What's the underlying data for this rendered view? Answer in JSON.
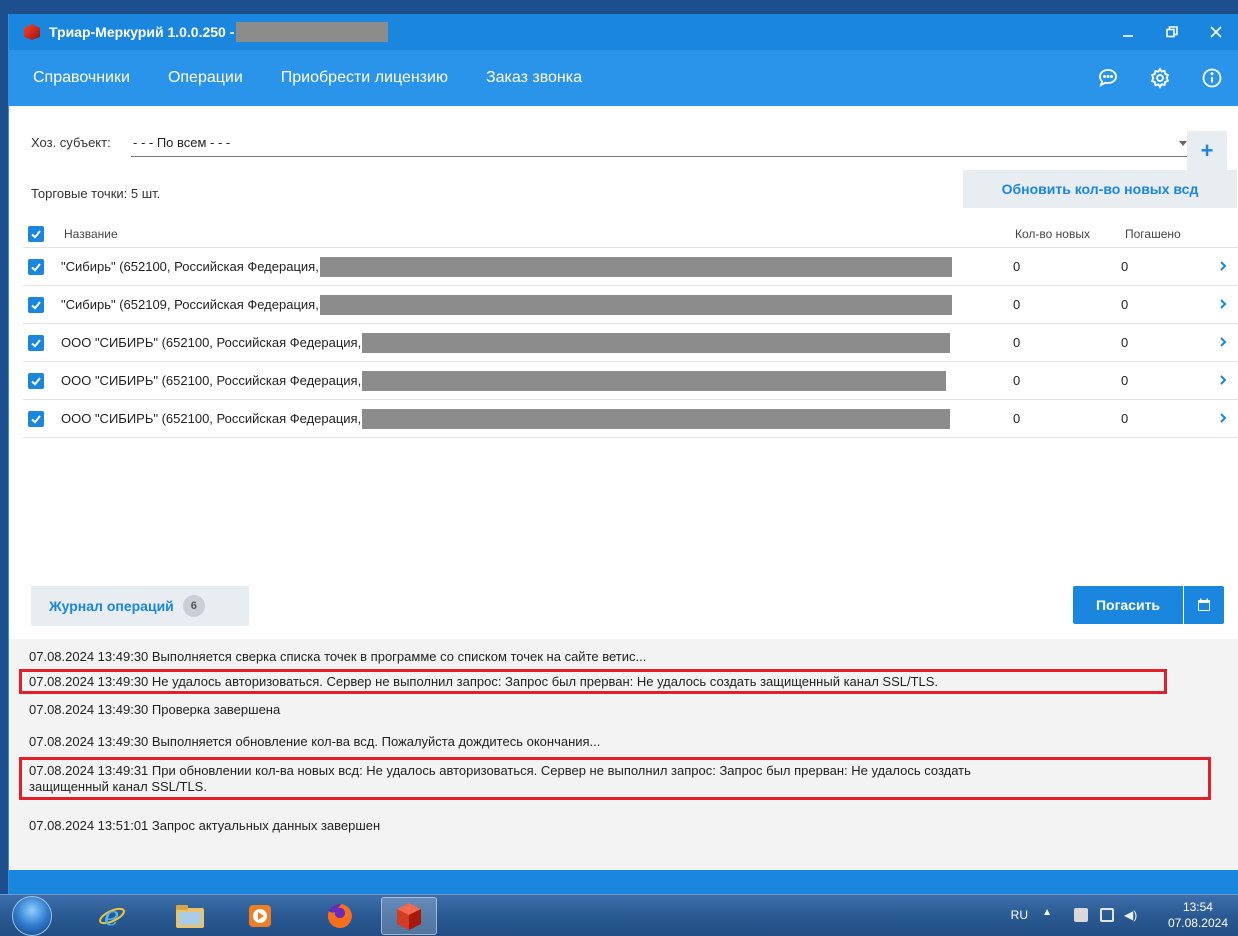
{
  "window": {
    "title": "Триар-Меркурий 1.0.0.250 -"
  },
  "menu": {
    "items": [
      "Справочники",
      "Операции",
      "Приобрести лицензию",
      "Заказ звонка"
    ]
  },
  "subject": {
    "label": "Хоз. субъект:",
    "value": "- - - По всем - - -"
  },
  "points": {
    "count_label": "Торговые точки: 5 шт.",
    "update_button": "Обновить кол-во новых всд"
  },
  "table": {
    "headers": {
      "name": "Название",
      "new": "Кол-во новых",
      "paid": "Погашено"
    },
    "rows": [
      {
        "name": "\"Сибирь\" (652100, Российская Федерация,",
        "new": "0",
        "paid": "0",
        "checked": true
      },
      {
        "name": "\"Сибирь\" (652109, Российская Федерация,",
        "new": "0",
        "paid": "0",
        "checked": true
      },
      {
        "name": "ООО \"СИБИРЬ\" (652100, Российская Федерация,",
        "new": "0",
        "paid": "0",
        "checked": true
      },
      {
        "name": "ООО \"СИБИРЬ\" (652100, Российская Федерация,",
        "new": "0",
        "paid": "0",
        "checked": true
      },
      {
        "name": "ООО \"СИБИРЬ\" (652100, Российская Федерация,",
        "new": "0",
        "paid": "0",
        "checked": true
      }
    ]
  },
  "journal": {
    "label": "Журнал операций",
    "count": "6"
  },
  "actions": {
    "pay_label": "Погасить"
  },
  "log": [
    "07.08.2024 13:49:30  Выполняется сверка списка точек в программе со списком точек на сайте ветис...",
    "07.08.2024 13:49:30  Не удалось авторизоваться.  Сервер не выполнил запрос:  Запрос был прерван: Не удалось создать защищенный канал SSL/TLS.",
    "07.08.2024 13:49:30  Проверка завершена",
    "07.08.2024 13:49:30  Выполняется обновление кол-ва всд. Пожалуйста дождитесь окончания...",
    "07.08.2024 13:49:31  При обновлении кол-ва новых всд: Не удалось авторизоваться.  Сервер не выполнил запрос:  Запрос был прерван: Не удалось создать",
    "защищенный канал SSL/TLS.",
    "07.08.2024 13:51:01  Запрос актуальных данных завершен"
  ],
  "taskbar": {
    "lang": "RU",
    "time": "13:54",
    "date": "07.08.2024"
  },
  "colors": {
    "accent": "#1a86de",
    "menu_bg": "#2a93ea",
    "highlight_border": "#e3202a"
  },
  "icons": [
    "app-icon",
    "minimize-icon",
    "restore-icon",
    "close-icon",
    "chat-icon",
    "settings-icon",
    "info-icon",
    "plus-icon",
    "check-icon",
    "chevron-right-icon",
    "calendar-icon"
  ]
}
